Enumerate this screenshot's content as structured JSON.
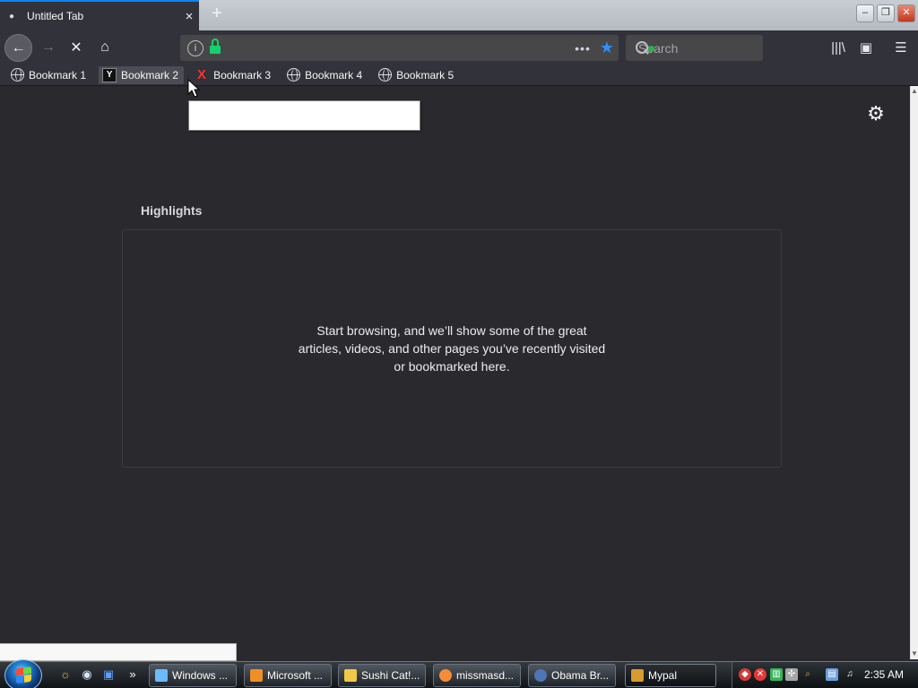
{
  "browser": {
    "tab": {
      "title": "Untitled Tab",
      "close": "×"
    },
    "new_tab": "+",
    "window_controls": {
      "minimize": "–",
      "restore": "❐",
      "close": "✕"
    },
    "nav": {
      "back": "←",
      "forward": "→",
      "stop": "✕",
      "home": "⌂"
    },
    "url": {
      "prefix": "",
      "host": "",
      "path": "",
      "more": "•••",
      "star": "★"
    },
    "search": {
      "placeholder": "Search"
    },
    "toolbar": {
      "library": "|||\\",
      "sidebar": "▣",
      "menu": "☰"
    },
    "bookmarks": [
      {
        "icon": "",
        "label": "Bookmark 1"
      },
      {
        "icon": "Y",
        "label": "Bookmark 2"
      },
      {
        "icon": "X",
        "label": "Bookmark 3"
      },
      {
        "icon": "",
        "label": "Bookmark 4"
      },
      {
        "icon": "",
        "label": "Bookmark 5"
      }
    ]
  },
  "page": {
    "settings_icon": "⚙",
    "highlights_title": "Highlights",
    "empty_message": "Start browsing, and we’ll show some of the great articles, videos, and other pages you’ve recently visited or bookmarked here."
  },
  "tooltip": {
    "title": "",
    "url": ""
  },
  "status": {
    "text": ""
  },
  "taskbar": {
    "overflow": "»",
    "items": [
      {
        "label": "Windows ...",
        "icon_color": "#6cbaff"
      },
      {
        "label": "Microsoft ...",
        "icon_color": "#ef8f24"
      },
      {
        "label": "Sushi Cat!...",
        "icon_color": "#f2c84b"
      },
      {
        "label": "missmasd...",
        "icon_color": "#f48d38"
      },
      {
        "label": "Obama Br...",
        "icon_color": "#4d76b7"
      },
      {
        "label": "Mypal",
        "icon_color": "#d99b2f"
      }
    ],
    "clock": "2:35 AM"
  },
  "colors": {
    "browser_bg": "#2a2a2e",
    "toolbar_bg": "#32323a",
    "accent": "#0a84ff",
    "secure_green": "#13d26b",
    "star_blue": "#2f8ff5"
  },
  "icons": {
    "cursor": "arrow-cursor-icon",
    "settings": "gear-icon",
    "lock": "lock-icon",
    "search": "search-icon"
  }
}
